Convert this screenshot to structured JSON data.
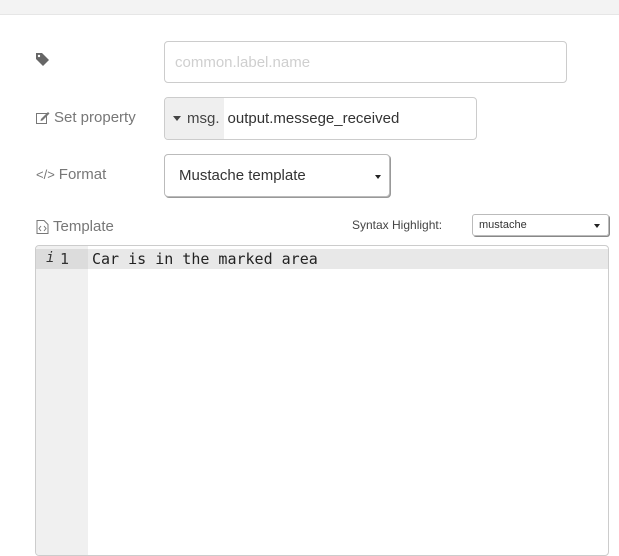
{
  "name_field": {
    "placeholder": "common.label.name",
    "icon": "tag-icon"
  },
  "property": {
    "label": "Set property",
    "icon": "edit-icon",
    "type_label": "msg.",
    "value": "output.messege_received"
  },
  "format": {
    "label": "Format",
    "icon": "code-icon",
    "selected": "Mustache template"
  },
  "template": {
    "label": "Template",
    "icon": "file-code-icon",
    "syntax_label": "Syntax Highlight:",
    "syntax_selected": "mustache"
  },
  "editor": {
    "lines": [
      {
        "number": "1",
        "text": "Car is in the marked area"
      }
    ],
    "info_glyph": "i"
  }
}
